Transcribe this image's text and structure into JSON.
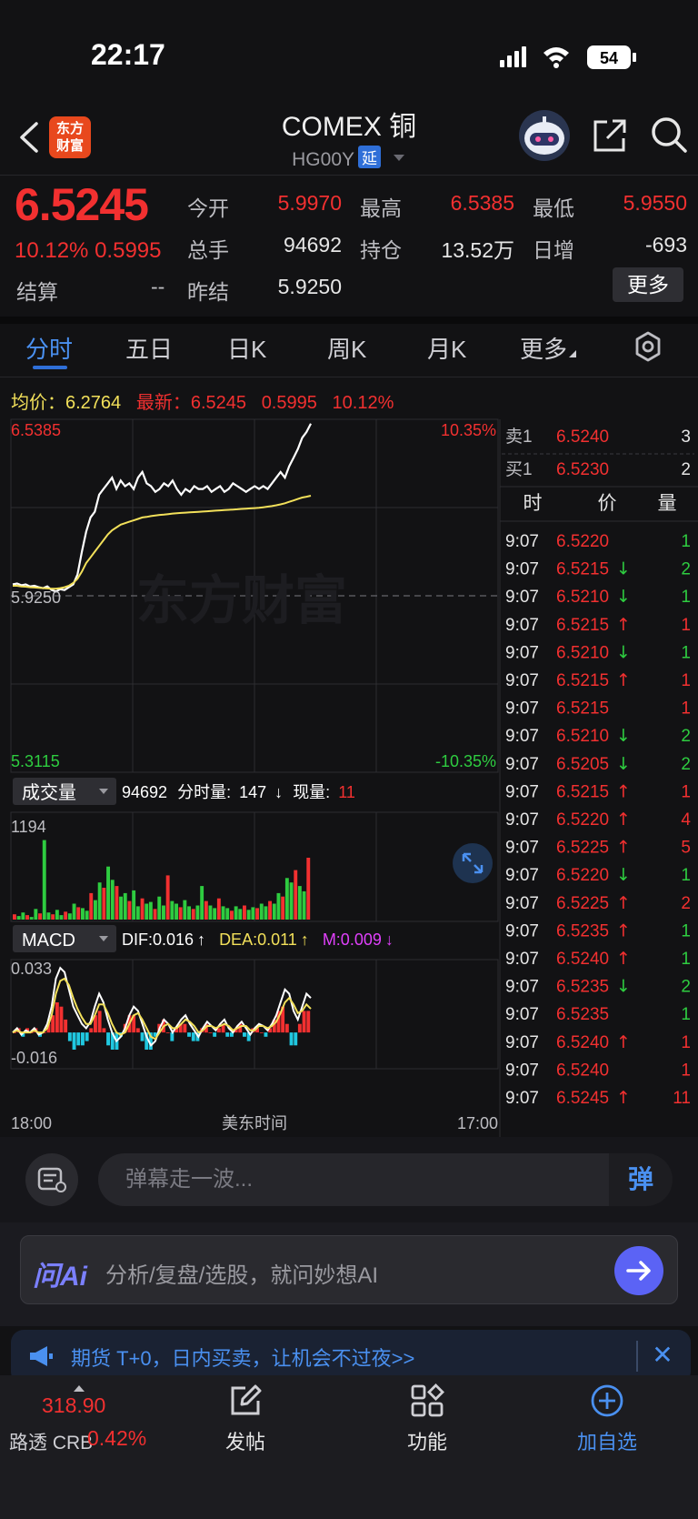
{
  "status": {
    "time": "22:17",
    "battery": "54"
  },
  "header": {
    "title": "COMEX 铜",
    "code": "HG00Y",
    "delay_badge": "延",
    "logo_line1": "东方",
    "logo_line2": "财富"
  },
  "quote": {
    "price": "6.5245",
    "change_pct": "10.12%",
    "change_abs": "0.5995",
    "settle_label": "结算",
    "settle_value": "--",
    "fields": [
      {
        "label": "今开",
        "value": "5.9970",
        "color": "#f23030"
      },
      {
        "label": "最高",
        "value": "6.5385",
        "color": "#f23030"
      },
      {
        "label": "最低",
        "value": "5.9550",
        "color": "#f23030"
      },
      {
        "label": "总手",
        "value": "94692",
        "color": "#e6e6e6"
      },
      {
        "label": "持仓",
        "value": "13.52万",
        "color": "#e6e6e6"
      },
      {
        "label": "日增",
        "value": "-693",
        "color": "#e6e6e6"
      },
      {
        "label": "昨结",
        "value": "5.9250",
        "color": "#e6e6e6"
      }
    ],
    "more_button": "更多"
  },
  "tabs": [
    "分时",
    "五日",
    "日K",
    "周K",
    "月K",
    "更多"
  ],
  "info_row": {
    "avg_label": "均价：",
    "avg_value": "6.2764",
    "latest_label": "最新：",
    "latest_value": "6.5245",
    "latest_change": "0.5995",
    "latest_pct": "10.12%"
  },
  "chart_data": [
    {
      "type": "line",
      "name_shown": "分时",
      "y_labels": {
        "top": "6.5385",
        "mid": "5.9250",
        "bottom": "5.3115",
        "top_pct": "10.35%",
        "bottom_pct": "-10.35%"
      },
      "ylim": [
        5.3115,
        6.5385
      ],
      "series": [
        {
          "name": "最新",
          "color": "#ffffff",
          "values": [
            5.965,
            5.968,
            5.962,
            5.965,
            5.958,
            5.96,
            5.955,
            5.952,
            5.958,
            5.945,
            5.94,
            5.948,
            5.945,
            5.955,
            5.965,
            6.0,
            6.08,
            6.15,
            6.2,
            6.22,
            6.28,
            6.3,
            6.32,
            6.34,
            6.3,
            6.33,
            6.31,
            6.32,
            6.3,
            6.34,
            6.36,
            6.32,
            6.31,
            6.29,
            6.3,
            6.32,
            6.31,
            6.33,
            6.3,
            6.28,
            6.3,
            6.29,
            6.31,
            6.3,
            6.3,
            6.31,
            6.29,
            6.3,
            6.31,
            6.29,
            6.3,
            6.32,
            6.31,
            6.3,
            6.29,
            6.3,
            6.31,
            6.3,
            6.31,
            6.3,
            6.32,
            6.34,
            6.36,
            6.34,
            6.38,
            6.41,
            6.44,
            6.48,
            6.5,
            6.53
          ]
        },
        {
          "name": "均价",
          "color": "#f2e05a",
          "values": [
            5.96,
            5.96,
            5.958,
            5.957,
            5.955,
            5.954,
            5.953,
            5.952,
            5.951,
            5.95,
            5.95,
            5.952,
            5.955,
            5.96,
            5.97,
            5.985,
            6.01,
            6.04,
            6.06,
            6.08,
            6.1,
            6.12,
            6.14,
            6.155,
            6.165,
            6.175,
            6.18,
            6.185,
            6.19,
            6.195,
            6.2,
            6.202,
            6.205,
            6.207,
            6.209,
            6.21,
            6.212,
            6.214,
            6.215,
            6.216,
            6.217,
            6.218,
            6.219,
            6.22,
            6.221,
            6.222,
            6.223,
            6.224,
            6.225,
            6.226,
            6.227,
            6.228,
            6.229,
            6.23,
            6.231,
            6.232,
            6.233,
            6.234,
            6.236,
            6.238,
            6.24,
            6.243,
            6.246,
            6.25,
            6.255,
            6.26,
            6.265,
            6.27,
            6.273,
            6.2764
          ]
        }
      ]
    },
    {
      "type": "bar",
      "name_shown": "成交量",
      "total": "94692",
      "per_minute_label": "分时量:",
      "per_minute": "147",
      "current_label": "现量:",
      "current": "11",
      "ylim": [
        0,
        1194
      ],
      "y_label_top": "1194",
      "values": [
        60,
        40,
        80,
        50,
        30,
        120,
        70,
        900,
        80,
        60,
        110,
        50,
        90,
        70,
        180,
        140,
        130,
        100,
        300,
        220,
        420,
        360,
        600,
        450,
        380,
        260,
        300,
        210,
        330,
        150,
        240,
        180,
        200,
        120,
        260,
        160,
        500,
        210,
        180,
        140,
        220,
        150,
        120,
        160,
        380,
        210,
        160,
        130,
        240,
        150,
        130,
        100,
        150,
        120,
        160,
        110,
        140,
        130,
        180,
        150,
        210,
        180,
        300,
        260,
        470,
        420,
        560,
        380,
        320,
        700
      ]
    },
    {
      "type": "line",
      "name_shown": "MACD",
      "dif_label": "DIF:0.016",
      "dea_label": "DEA:0.011",
      "m_label": "M:0.009",
      "y_labels": {
        "top": "0.033",
        "bottom": "-0.016"
      },
      "ylim": [
        -0.016,
        0.033
      ],
      "series": [
        {
          "name": "DIF",
          "color": "#ffffff",
          "values": [
            0.0,
            0.002,
            -0.001,
            0.001,
            0.0,
            0.002,
            -0.001,
            0.0,
            0.004,
            0.012,
            0.025,
            0.03,
            0.028,
            0.02,
            0.012,
            0.008,
            0.004,
            0.002,
            0.005,
            0.012,
            0.018,
            0.014,
            0.006,
            0.0,
            -0.004,
            -0.002,
            0.002,
            0.008,
            0.012,
            0.01,
            0.004,
            -0.002,
            -0.006,
            -0.004,
            0.002,
            0.006,
            0.004,
            0.0,
            0.003,
            0.006,
            0.008,
            0.004,
            0.001,
            -0.002,
            0.002,
            0.005,
            0.003,
            0.001,
            0.004,
            0.006,
            0.002,
            0.0,
            0.003,
            0.005,
            0.002,
            -0.001,
            0.002,
            0.004,
            0.003,
            0.001,
            0.004,
            0.008,
            0.014,
            0.02,
            0.018,
            0.01,
            0.006,
            0.012,
            0.018,
            0.016
          ]
        },
        {
          "name": "DEA",
          "color": "#f2e05a",
          "values": [
            0.0,
            0.001,
            0.0,
            0.0,
            0.0,
            0.001,
            0.0,
            0.0,
            0.002,
            0.008,
            0.018,
            0.024,
            0.025,
            0.022,
            0.016,
            0.011,
            0.007,
            0.004,
            0.004,
            0.008,
            0.013,
            0.013,
            0.009,
            0.004,
            0.0,
            -0.001,
            0.0,
            0.004,
            0.008,
            0.009,
            0.006,
            0.002,
            -0.002,
            -0.003,
            0.0,
            0.003,
            0.004,
            0.002,
            0.002,
            0.004,
            0.006,
            0.005,
            0.003,
            0.0,
            0.001,
            0.003,
            0.003,
            0.002,
            0.003,
            0.004,
            0.003,
            0.001,
            0.002,
            0.003,
            0.003,
            0.001,
            0.001,
            0.003,
            0.003,
            0.002,
            0.003,
            0.005,
            0.009,
            0.014,
            0.016,
            0.013,
            0.009,
            0.01,
            0.013,
            0.011
          ]
        }
      ]
    }
  ],
  "x_axis": {
    "start": "18:00",
    "middle": "美东时间",
    "end": "17:00"
  },
  "order_book": {
    "sell_label": "卖1",
    "sell_price": "6.5240",
    "sell_qty": "3",
    "buy_label": "买1",
    "buy_price": "6.5230",
    "buy_qty": "2",
    "header_time": "时",
    "header_price": "价",
    "header_qty": "量"
  },
  "ticks": [
    {
      "time": "9:07",
      "price": "6.5220",
      "dir": "",
      "qty": "1",
      "qty_color": "#2ecc40"
    },
    {
      "time": "9:07",
      "price": "6.5215",
      "dir": "↓",
      "qty": "2",
      "qty_color": "#2ecc40"
    },
    {
      "time": "9:07",
      "price": "6.5210",
      "dir": "↓",
      "qty": "1",
      "qty_color": "#2ecc40"
    },
    {
      "time": "9:07",
      "price": "6.5215",
      "dir": "↑",
      "qty": "1",
      "qty_color": "#f23030"
    },
    {
      "time": "9:07",
      "price": "6.5210",
      "dir": "↓",
      "qty": "1",
      "qty_color": "#2ecc40"
    },
    {
      "time": "9:07",
      "price": "6.5215",
      "dir": "↑",
      "qty": "1",
      "qty_color": "#f23030"
    },
    {
      "time": "9:07",
      "price": "6.5215",
      "dir": "",
      "qty": "1",
      "qty_color": "#f23030"
    },
    {
      "time": "9:07",
      "price": "6.5210",
      "dir": "↓",
      "qty": "2",
      "qty_color": "#2ecc40"
    },
    {
      "time": "9:07",
      "price": "6.5205",
      "dir": "↓",
      "qty": "2",
      "qty_color": "#2ecc40"
    },
    {
      "time": "9:07",
      "price": "6.5215",
      "dir": "↑",
      "qty": "1",
      "qty_color": "#f23030"
    },
    {
      "time": "9:07",
      "price": "6.5220",
      "dir": "↑",
      "qty": "4",
      "qty_color": "#f23030"
    },
    {
      "time": "9:07",
      "price": "6.5225",
      "dir": "↑",
      "qty": "5",
      "qty_color": "#f23030"
    },
    {
      "time": "9:07",
      "price": "6.5220",
      "dir": "↓",
      "qty": "1",
      "qty_color": "#2ecc40"
    },
    {
      "time": "9:07",
      "price": "6.5225",
      "dir": "↑",
      "qty": "2",
      "qty_color": "#f23030"
    },
    {
      "time": "9:07",
      "price": "6.5235",
      "dir": "↑",
      "qty": "1",
      "qty_color": "#2ecc40"
    },
    {
      "time": "9:07",
      "price": "6.5240",
      "dir": "↑",
      "qty": "1",
      "qty_color": "#2ecc40"
    },
    {
      "time": "9:07",
      "price": "6.5235",
      "dir": "↓",
      "qty": "2",
      "qty_color": "#2ecc40"
    },
    {
      "time": "9:07",
      "price": "6.5235",
      "dir": "",
      "qty": "1",
      "qty_color": "#2ecc40"
    },
    {
      "time": "9:07",
      "price": "6.5240",
      "dir": "↑",
      "qty": "1",
      "qty_color": "#f23030"
    },
    {
      "time": "9:07",
      "price": "6.5240",
      "dir": "",
      "qty": "1",
      "qty_color": "#f23030"
    },
    {
      "time": "9:07",
      "price": "6.5245",
      "dir": "↑",
      "qty": "11",
      "qty_color": "#f23030"
    }
  ],
  "danmu": {
    "placeholder": "弹幕走一波...",
    "send_label": "弹"
  },
  "ai_bar": {
    "logo": "问Ai",
    "placeholder": "分析/复盘/选股，就问妙想AI"
  },
  "promo": {
    "text": "期货 T+0，日内买卖，让机会不过夜>>",
    "close": "✕"
  },
  "bottom_nav": {
    "crb_value": "318.90",
    "crb_label": "路透 CRB",
    "crb_pct": "0.42%",
    "items": [
      {
        "label": "发帖",
        "icon": "edit-icon"
      },
      {
        "label": "功能",
        "icon": "grid-icon"
      },
      {
        "label": "加自选",
        "icon": "plus-circle-icon"
      }
    ]
  },
  "watermark": "东方财富",
  "colors": {
    "up": "#f23030",
    "down": "#2ecc40",
    "accent": "#2f6fd8",
    "avg_line": "#f2e05a"
  }
}
